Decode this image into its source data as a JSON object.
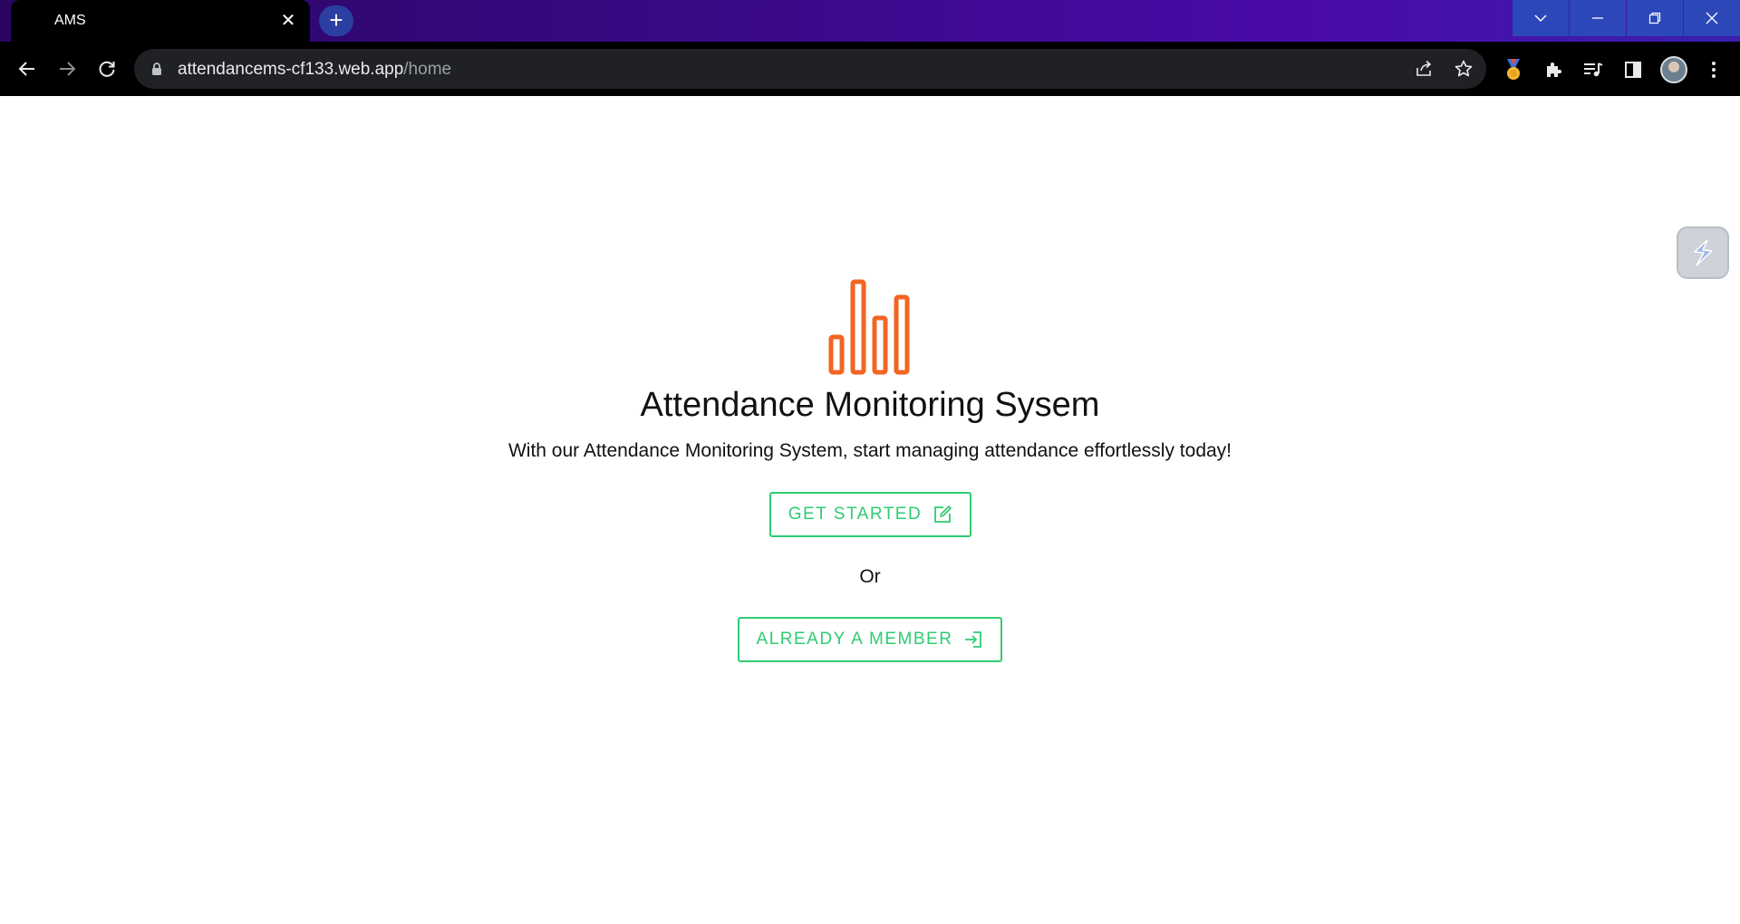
{
  "browser": {
    "tab": {
      "title": "AMS",
      "close_icon": "close-icon"
    },
    "new_tab_icon": "plus-icon",
    "window_controls": [
      "chevron-down-icon",
      "minimize-icon",
      "restore-icon",
      "close-icon"
    ],
    "address": {
      "host": "attendancems-cf133.web.app",
      "path": "/home"
    },
    "nav_icons": [
      "back-arrow-icon",
      "forward-arrow-icon",
      "reload-icon"
    ],
    "omnibox_icons": [
      "share-icon",
      "star-icon"
    ],
    "toolbar_icons": [
      "medal-extension-icon",
      "puzzle-extensions-icon",
      "media-playlist-icon",
      "side-panel-icon",
      "profile-avatar",
      "more-vert-icon"
    ]
  },
  "page": {
    "logo_icon": "bar-chart-logo-icon",
    "logo_color": "#f26522",
    "title": "Attendance Monitoring Sysem",
    "subtitle": "With our Attendance Monitoring System, start managing attendance effortlessly today!",
    "get_started_label": "GET STARTED",
    "or_label": "Or",
    "member_label": "ALREADY A MEMBER",
    "accent_color": "#2ecc71",
    "side_widget_icon": "lightning-extension-icon"
  }
}
